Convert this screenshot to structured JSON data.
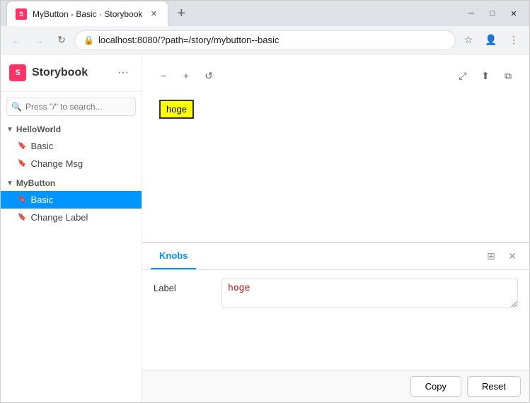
{
  "browser": {
    "tab_favicon": "S",
    "tab_title": "MyButton - Basic · Storybook",
    "new_tab_icon": "+",
    "window_minimize": "─",
    "window_maximize": "□",
    "window_close": "✕",
    "nav_back": "←",
    "nav_forward": "→",
    "nav_reload": "↻",
    "address_lock": "🔒",
    "address_url": "localhost:8080/?path=/story/mybutton--basic",
    "nav_star": "☆",
    "nav_profile": "👤",
    "nav_menu": "⋮"
  },
  "sidebar": {
    "logo_text": "Storybook",
    "logo_icon": "S",
    "menu_icon": "···",
    "search_placeholder": "Press \"/\" to search...",
    "groups": [
      {
        "id": "helloworld",
        "title": "HelloWorld",
        "expanded": true,
        "items": [
          {
            "id": "basic",
            "label": "Basic",
            "active": false
          },
          {
            "id": "changemsg",
            "label": "Change Msg",
            "active": false
          }
        ]
      },
      {
        "id": "mybutton",
        "title": "MyButton",
        "expanded": true,
        "items": [
          {
            "id": "basic2",
            "label": "Basic",
            "active": true
          },
          {
            "id": "changelabel",
            "label": "Change Label",
            "active": false
          }
        ]
      }
    ]
  },
  "preview": {
    "zoom_in": "−",
    "zoom_out": "+",
    "reset_zoom": "↺",
    "expand_icon": "⤢",
    "share_icon": "⬆",
    "copy_icon": "⧉",
    "demo_button_label": "hoge"
  },
  "knobs": {
    "tab_label": "Knobs",
    "grid_icon": "⊞",
    "close_icon": "✕",
    "label_field": "Label",
    "label_value": "hoge",
    "label_placeholder": ""
  },
  "bottom_bar": {
    "copy_label": "Copy",
    "reset_label": "Reset"
  }
}
